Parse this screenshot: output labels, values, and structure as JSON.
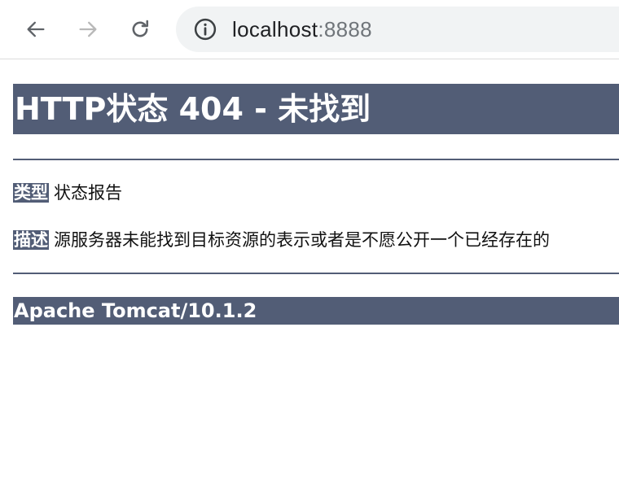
{
  "browser": {
    "url_host": "localhost",
    "url_port": ":8888",
    "icons": {
      "back": "arrow-left",
      "forward": "arrow-right",
      "reload": "reload",
      "site_info": "info-circle"
    }
  },
  "page": {
    "title": "HTTP状态 404 - 未找到",
    "type_label": "类型",
    "type_value": "状态报告",
    "description_label": "描述",
    "description_value": "源服务器未能找到目标资源的表示或者是不愿公开一个已经存在的",
    "footer": "Apache Tomcat/10.1.2"
  },
  "colors": {
    "header_bg": "#525d76",
    "omnibox_bg": "#f1f3f4"
  }
}
